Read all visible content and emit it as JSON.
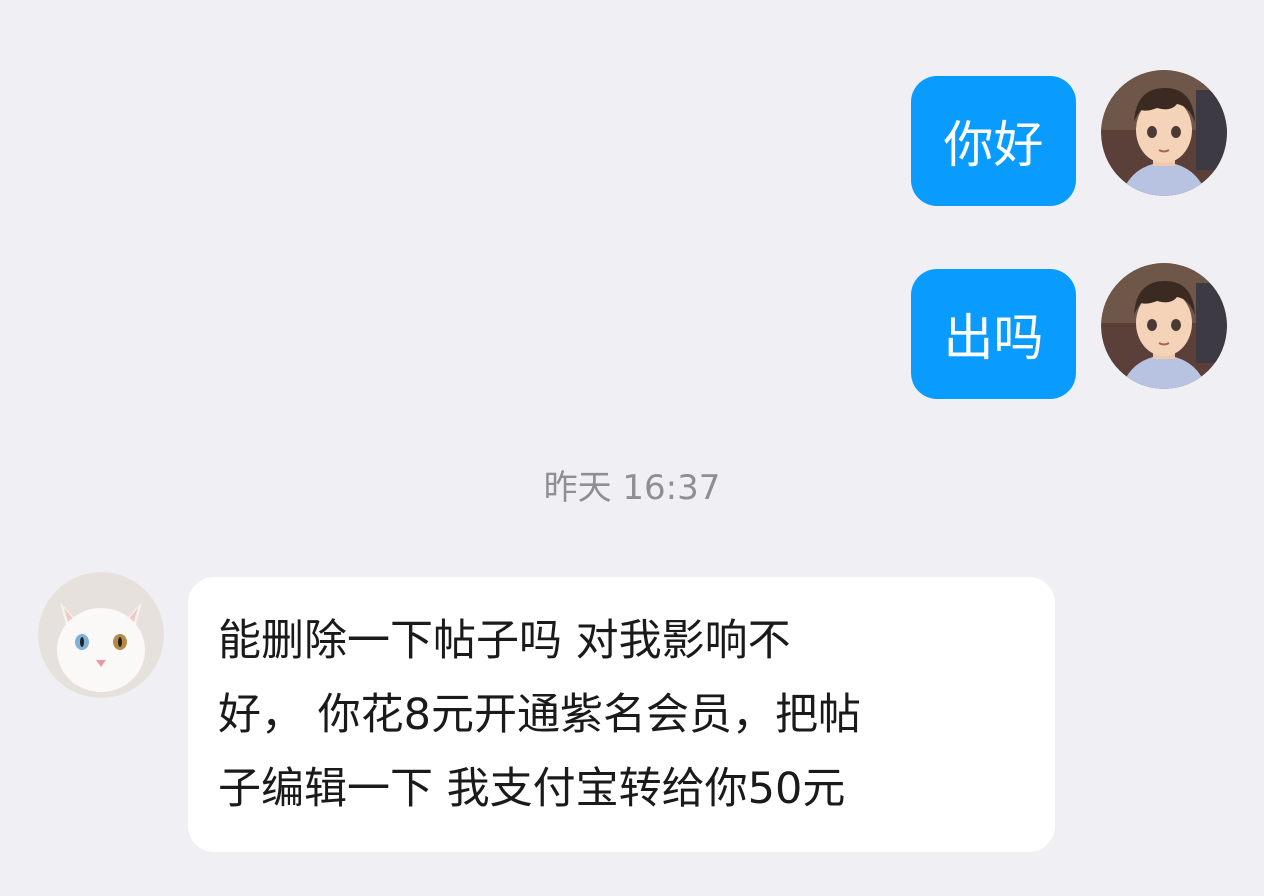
{
  "messages": {
    "outgoing": [
      {
        "text": "你好"
      },
      {
        "text": "出吗"
      }
    ],
    "timestamp": "昨天 16:37",
    "incoming": {
      "text": "能删除一下帖子吗 对我影响不\n好， 你花8元开通紫名会员，把帖\n子编辑一下 我支付宝转给你50元"
    }
  },
  "colors": {
    "outgoing_bubble": "#0a9bff",
    "incoming_bubble": "#ffffff",
    "background": "#f0f0f4"
  },
  "icons": {
    "self_avatar": "anime-boy-avatar-icon",
    "other_avatar": "white-cat-avatar-icon"
  }
}
